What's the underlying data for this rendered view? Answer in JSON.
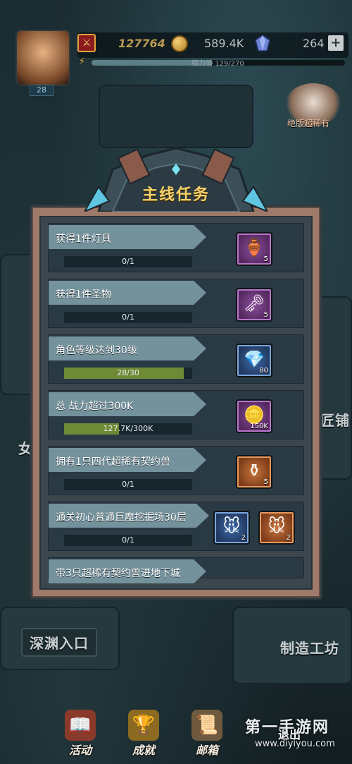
{
  "hud": {
    "combat_power": "127764",
    "coins": "589.4K",
    "gems": "264",
    "plus_label": "+",
    "energy_text": "精力值 129/270",
    "energy_fraction": 0.478,
    "player_level": "28",
    "event_label": "绝版超稀有"
  },
  "scene": {
    "abyss_label": "深渊入口",
    "workshop_label": "制造工坊",
    "craftsman_label": "匠铺",
    "side_label": "女"
  },
  "panel": {
    "title": "主线任务",
    "tasks": [
      {
        "title": "获得1件灯具",
        "progress_text": "0/1",
        "progress": 0,
        "rewards": [
          {
            "icon": "lamp-icon",
            "count": "5",
            "rarity": "purple"
          }
        ]
      },
      {
        "title": "获得1件圣物",
        "progress_text": "0/1",
        "progress": 0,
        "rewards": [
          {
            "icon": "key-icon",
            "count": "5",
            "rarity": "purple"
          }
        ]
      },
      {
        "title": "角色等级达到30级",
        "progress_text": "28/30",
        "progress": 0.933,
        "rewards": [
          {
            "icon": "crystal-icon",
            "count": "80",
            "rarity": "blue"
          }
        ]
      },
      {
        "title": "总 战力超过300K",
        "progress_text": "127.7K/300K",
        "progress": 0.426,
        "rewards": [
          {
            "icon": "coin-icon",
            "count": "150K",
            "rarity": "purple"
          }
        ]
      },
      {
        "title": "拥有1只四代超稀有契约兽",
        "progress_text": "0/1",
        "progress": 0,
        "rewards": [
          {
            "icon": "urn-icon",
            "count": "5",
            "rarity": "orange"
          }
        ]
      },
      {
        "title": "通关初心普通巨魔挖掘场30层",
        "progress_text": "0/1",
        "progress": 0,
        "rewards": [
          {
            "icon": "beast-icon",
            "count": "2",
            "rarity": "blue"
          },
          {
            "icon": "beast-icon",
            "count": "2",
            "rarity": "orange"
          }
        ]
      },
      {
        "title": "带3只超稀有契约兽进地下城",
        "progress_text": "",
        "progress": 0,
        "rewards": []
      }
    ]
  },
  "bottom_nav": {
    "items": [
      {
        "label": "活动",
        "icon": "activity-icon"
      },
      {
        "label": "成就",
        "icon": "achievement-icon"
      },
      {
        "label": "邮箱",
        "icon": "mailbox-icon"
      }
    ],
    "exit_label": "退出"
  },
  "watermark": {
    "title": "第一手游网",
    "url": "www.diyiyou.com"
  }
}
